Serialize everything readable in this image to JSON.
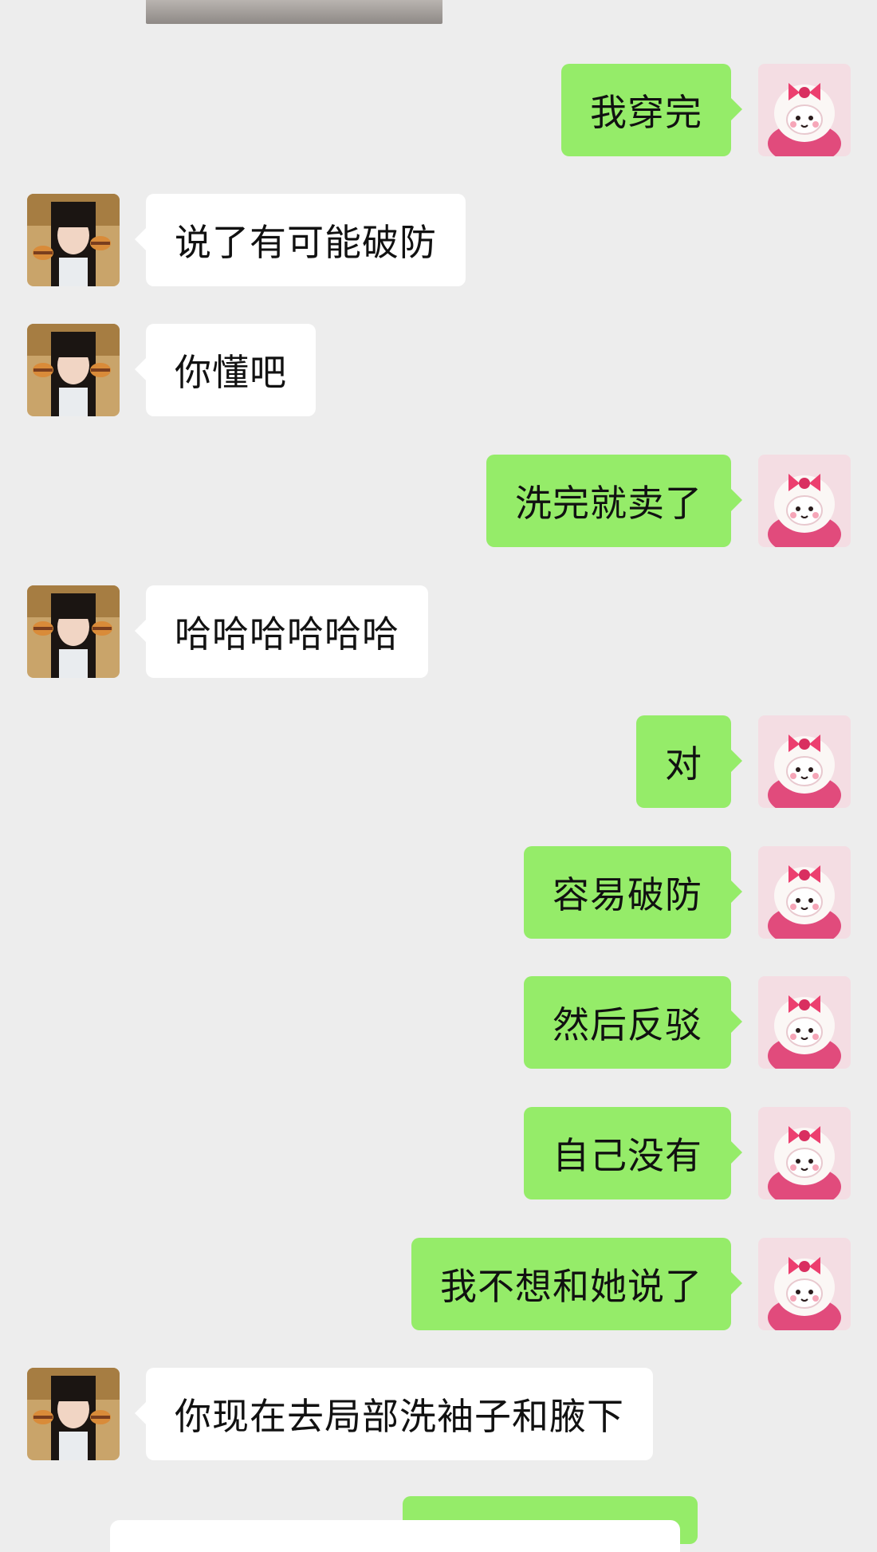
{
  "colors": {
    "background": "#ededed",
    "incoming_bubble": "#ffffff",
    "outgoing_bubble": "#95ec69"
  },
  "avatars": {
    "contact": "girl-holding-burgers-photo",
    "self": "pink-bow-plush-cat-photo"
  },
  "messages": [
    {
      "side": "out",
      "text": "我穿完"
    },
    {
      "side": "in",
      "text": "说了有可能破防"
    },
    {
      "side": "in",
      "text": "你懂吧"
    },
    {
      "side": "out",
      "text": "洗完就卖了"
    },
    {
      "side": "in",
      "text": "哈哈哈哈哈哈"
    },
    {
      "side": "out",
      "text": "对"
    },
    {
      "side": "out",
      "text": "容易破防"
    },
    {
      "side": "out",
      "text": "然后反驳"
    },
    {
      "side": "out",
      "text": "自己没有"
    },
    {
      "side": "out",
      "text": "我不想和她说了"
    },
    {
      "side": "in",
      "text": "你现在去局部洗袖子和腋下"
    }
  ]
}
